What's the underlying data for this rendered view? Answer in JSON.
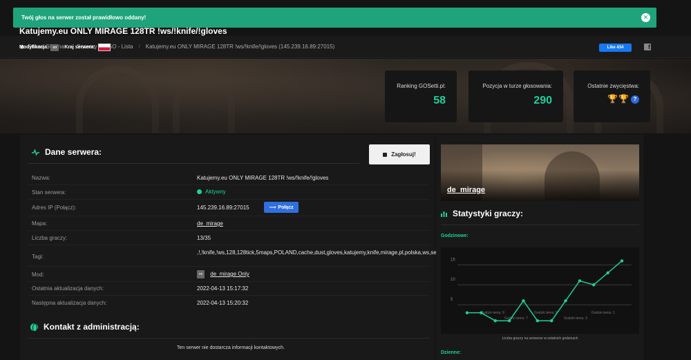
{
  "toast": {
    "message": "Twój głos na serwer został prawidłowo oddany!"
  },
  "breadcrumb": {
    "items": [
      "Strona Główna",
      "Serwery CS:GO - Lista",
      "Katujemy.eu ONLY MIRAGE 128TR !ws/!knife/!gloves (145.239.16.89:27015)"
    ]
  },
  "social": {
    "fb_like": "Like 434",
    "fb_icon": "f"
  },
  "server": {
    "title": "Katujemy.eu ONLY MIRAGE 128TR !ws/!knife/!gloves",
    "mod_label": "Modyfikacja:",
    "mod_badge": "mi",
    "country_label": "Kraj serwera:"
  },
  "stats": {
    "ranking_label": "Ranking GOSetti.pl:",
    "ranking_value": "58",
    "position_label": "Pozycja w turze głosowania:",
    "position_value": "290",
    "wins_label": "Ostatnie zwycięstwa:",
    "wins_help": "?"
  },
  "details": {
    "title": "Dane serwera:",
    "vote_button": "Zagłosuj!",
    "rows": [
      {
        "label": "Nazwa:",
        "value": "Katujemy.eu ONLY MIRAGE 128TR !ws/!knife/!gloves"
      },
      {
        "label": "Stan serwera:",
        "value": "Aktywny"
      },
      {
        "label": "Adres IP (Połącz):",
        "value": "145.239.16.89:27015"
      },
      {
        "label": "Mapa:",
        "value": "de_mirage"
      },
      {
        "label": "Liczba graczy:",
        "value": "13/35"
      },
      {
        "label": "Tagi:",
        "value": ",!,!knife,!ws,128,128tick,5maps,POLAND,cache,dust,gloves,katujemy,knife,mirage,pl,polska,ws,secure"
      },
      {
        "label": "Mod:",
        "value": "de_mirage Only",
        "badge": "mi"
      },
      {
        "label": "Ostatnia aktualizacja danych:",
        "value": "2022-04-13 15:17:32"
      },
      {
        "label": "Następna aktualizacja danych:",
        "value": "2022-04-13 15:20:32"
      }
    ],
    "connect_button": "Połącz"
  },
  "contact": {
    "title": "Kontakt z administracją:",
    "text": "Ten serwer nie dostarcza informacji kontaktowych."
  },
  "map_card": {
    "name": "de_mirage"
  },
  "player_stats": {
    "title": "Statystyki graczy:",
    "hourly_label": "Godzinowe:",
    "daily_label": "Dzienne:",
    "caption": "Liczba graczy na serwerze w ostatnich godzinach",
    "tooltips": [
      "Godzin temu: 9",
      "Godzin temu: 5",
      "Godzin temu: 1",
      "Godzin temu: 7",
      "Godzin temu: 3"
    ]
  },
  "chart_data": {
    "type": "line",
    "title": "",
    "xlabel": "",
    "ylabel": "",
    "ylim": [
      0,
      18
    ],
    "y_ticks": [
      5,
      10,
      15
    ],
    "x": [
      1,
      2,
      3,
      4,
      5,
      6,
      7,
      8,
      9,
      10,
      11,
      12
    ],
    "series": [
      {
        "values": [
          3,
          3,
          1,
          1,
          6,
          1,
          1,
          6,
          11,
          10,
          13,
          16
        ]
      }
    ],
    "color": "#1fd09a"
  },
  "colors": {
    "accent": "#1fd09a",
    "toast": "#1fa37b",
    "connect": "#2f6fe0",
    "trophy": "#f0b400"
  }
}
